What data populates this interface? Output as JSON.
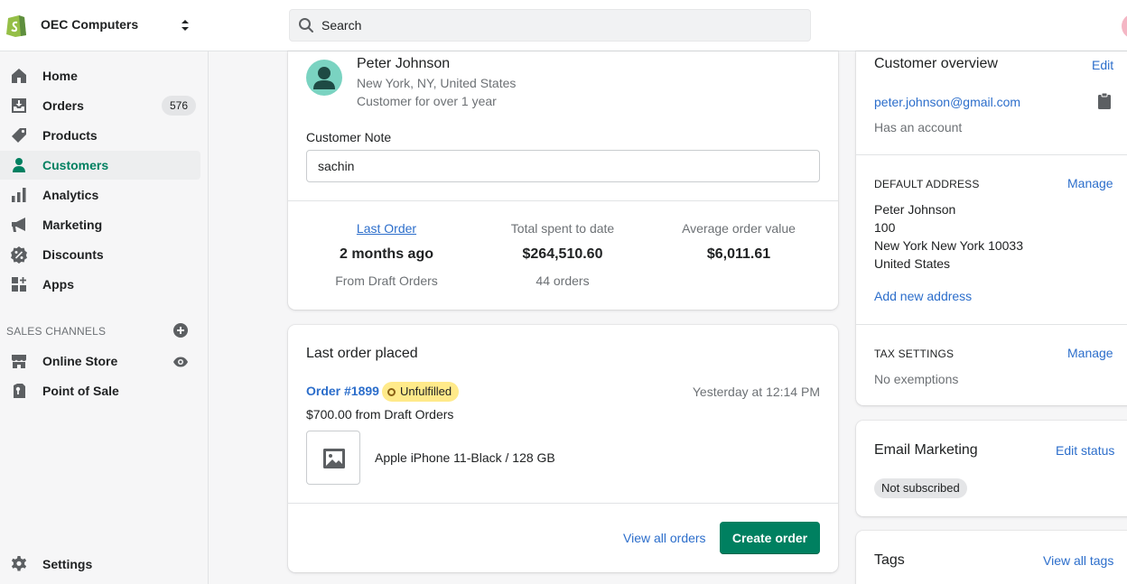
{
  "topbar": {
    "store_name": "OEC Computers",
    "search_placeholder": "Search"
  },
  "sidebar": {
    "items": [
      {
        "label": "Home",
        "icon": "home-icon"
      },
      {
        "label": "Orders",
        "icon": "orders-icon",
        "badge": "576"
      },
      {
        "label": "Products",
        "icon": "tag-icon"
      },
      {
        "label": "Customers",
        "icon": "person-icon",
        "active": true
      },
      {
        "label": "Analytics",
        "icon": "bar-chart-icon"
      },
      {
        "label": "Marketing",
        "icon": "megaphone-icon"
      },
      {
        "label": "Discounts",
        "icon": "discount-icon"
      },
      {
        "label": "Apps",
        "icon": "apps-icon"
      }
    ],
    "sales_channels_heading": "SALES CHANNELS",
    "channels": [
      {
        "label": "Online Store",
        "icon": "store-icon"
      },
      {
        "label": "Point of Sale",
        "icon": "pos-icon"
      }
    ],
    "settings_label": "Settings"
  },
  "customer": {
    "name": "Peter Johnson",
    "location": "New York, NY, United States",
    "since": "Customer for over 1 year",
    "note_label": "Customer Note",
    "note_value": "sachin",
    "stats": {
      "last_order_label": "Last Order",
      "last_order_value": "2 months ago",
      "last_order_sub": "From Draft Orders",
      "total_label": "Total spent to date",
      "total_value": "$264,510.60",
      "total_sub": "44 orders",
      "avg_label": "Average order value",
      "avg_value": "$6,011.61"
    }
  },
  "last_order": {
    "title": "Last order placed",
    "order_number": "Order #1899",
    "status": "Unfulfilled",
    "time": "Yesterday at 12:14 PM",
    "amount": "$700.00 from Draft Orders",
    "product": "Apple iPhone 11-Black / 128 GB",
    "view_all": "View all orders",
    "create": "Create order"
  },
  "overview": {
    "title": "Customer overview",
    "edit": "Edit",
    "email": "peter.johnson@gmail.com",
    "account": "Has an account",
    "address_heading": "DEFAULT ADDRESS",
    "address_manage": "Manage",
    "address_lines": [
      "Peter Johnson",
      "100",
      "New York New York 10033",
      "United States"
    ],
    "add_address": "Add new address",
    "tax_heading": "TAX SETTINGS",
    "tax_manage": "Manage",
    "tax_value": "No exemptions"
  },
  "email_marketing": {
    "title": "Email Marketing",
    "edit": "Edit status",
    "status": "Not subscribed"
  },
  "tags": {
    "title": "Tags",
    "view_all": "View all tags"
  },
  "colors": {
    "accent": "#008060",
    "link": "#2c6ecb",
    "warning_badge": "#ffea8a"
  }
}
